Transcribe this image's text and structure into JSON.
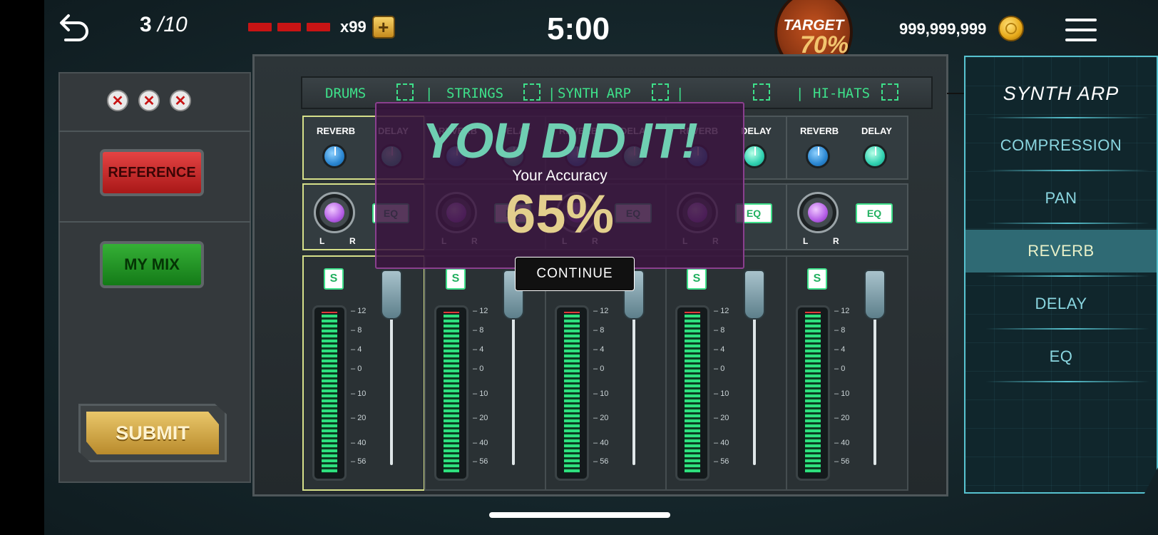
{
  "header": {
    "progress_current": "3",
    "progress_total": "/10",
    "lives_count": "x99",
    "add_label": "+",
    "timer": "5:00",
    "target_label": "TARGET",
    "target_value": "70%",
    "coins": "999,999,999"
  },
  "left_panel": {
    "strike_glyph": "✕",
    "reference_label": "REFERENCE",
    "mymix_label": "MY MIX",
    "submit_label": "SUBMIT"
  },
  "tabs": [
    "DRUMS",
    "STRINGS",
    "SYNTH ARP",
    "",
    "HI-HATS"
  ],
  "tab_separator": "|",
  "channel": {
    "reverb_label": "REVERB",
    "delay_label": "DELAY",
    "pan_left": "L",
    "pan_right": "R",
    "eq_label": "EQ",
    "solo_label": "S",
    "scale": [
      "12",
      "8",
      "4",
      "0",
      "10",
      "20",
      "40",
      "56"
    ]
  },
  "result": {
    "title": "YOU DID IT!",
    "accuracy_label": "Your Accuracy",
    "accuracy_value": "65%",
    "continue_label": "CONTINUE"
  },
  "right_panel": {
    "title": "SYNTH ARP",
    "items": [
      "COMPRESSION",
      "PAN",
      "REVERB",
      "DELAY",
      "EQ"
    ],
    "active_index": 2
  },
  "colors": {
    "accent_green": "#3ee08a",
    "accent_teal": "#57c2cf",
    "target_orange": "#c4521f",
    "reference_red": "#d42a2a",
    "mymix_green": "#27a02a",
    "submit_gold": "#d9b24f"
  },
  "icons": {
    "back": "back-arrow-icon",
    "menu": "hamburger-menu-icon",
    "coin": "coin-icon"
  }
}
